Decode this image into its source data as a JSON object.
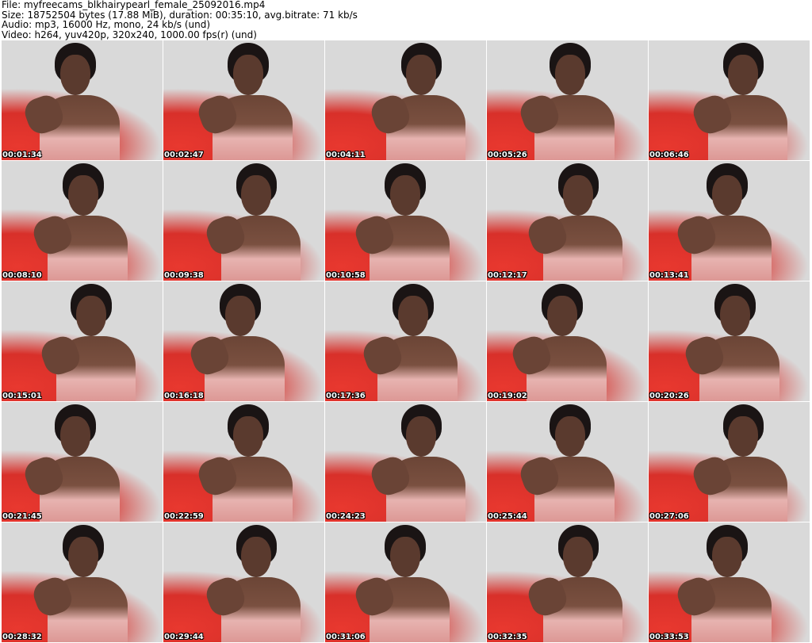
{
  "header": {
    "lines": [
      "File: myfreecams_blkhairypearl_female_25092016.mp4",
      "Size: 18752504 bytes (17.88 MiB), duration: 00:35:10, avg.bitrate: 71 kb/s",
      "Audio: mp3, 16000 Hz, mono, 24 kb/s (und)",
      "Video: h264, yuv420p, 320x240, 1000.00 fps(r) (und)"
    ]
  },
  "thumbnails": [
    "00:01:34",
    "00:02:47",
    "00:04:11",
    "00:05:26",
    "00:06:46",
    "00:08:10",
    "00:09:38",
    "00:10:58",
    "00:12:17",
    "00:13:41",
    "00:15:01",
    "00:16:18",
    "00:17:36",
    "00:19:02",
    "00:20:26",
    "00:21:45",
    "00:22:59",
    "00:24:23",
    "00:25:44",
    "00:27:06",
    "00:28:32",
    "00:29:44",
    "00:31:06",
    "00:32:35",
    "00:33:53"
  ]
}
